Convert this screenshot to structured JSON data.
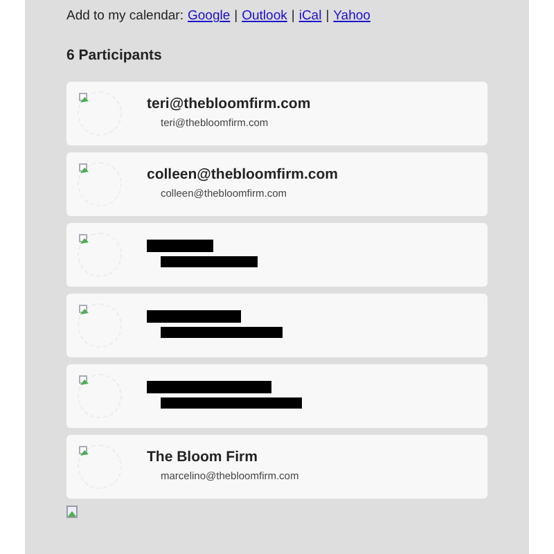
{
  "calendar": {
    "label": "Add to my calendar:",
    "links": [
      {
        "text": "Google"
      },
      {
        "text": "Outlook"
      },
      {
        "text": "iCal"
      },
      {
        "text": "Yahoo"
      }
    ],
    "separator": "|"
  },
  "participants_heading": "6 Participants",
  "participants": [
    {
      "kind": "shown",
      "name": "teri@thebloomfirm.com",
      "email": "teri@thebloomfirm.com"
    },
    {
      "kind": "shown",
      "name": "colleen@thebloomfirm.com",
      "email": "colleen@thebloomfirm.com"
    },
    {
      "kind": "redacted"
    },
    {
      "kind": "redacted"
    },
    {
      "kind": "redacted"
    },
    {
      "kind": "shown",
      "name": "The Bloom Firm",
      "email": "marcelino@thebloomfirm.com"
    }
  ],
  "footer_image": {
    "kind": "broken_image"
  }
}
